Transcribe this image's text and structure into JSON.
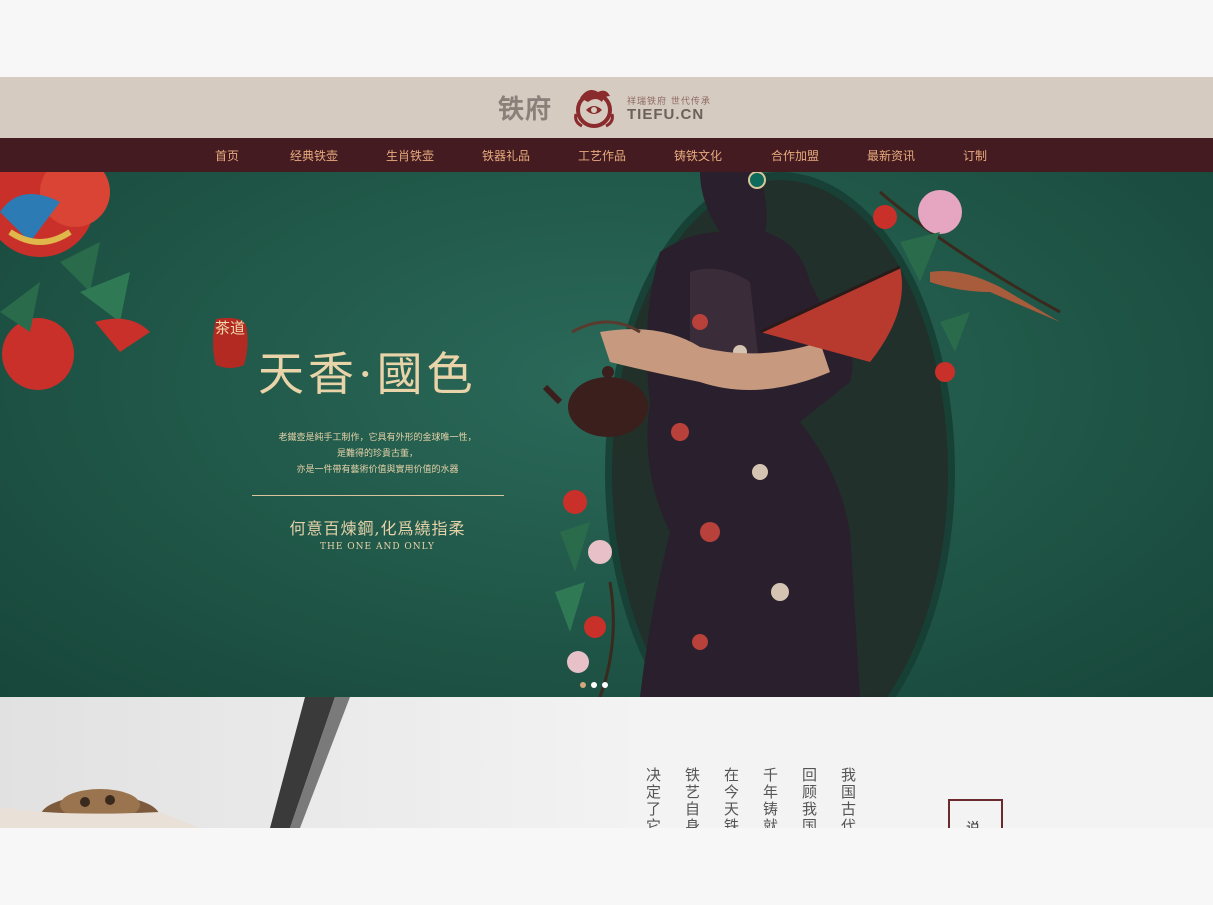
{
  "header": {
    "logo_text": "铁府",
    "logo_tagline": "祥瑞铁府 世代传承",
    "logo_domain": "TIEFU.CN"
  },
  "nav": {
    "items": [
      "首页",
      "经典铁壶",
      "生肖铁壶",
      "铁器礼品",
      "工艺作品",
      "铸铁文化",
      "合作加盟",
      "最新资讯",
      "订制"
    ]
  },
  "banner": {
    "seal_text": "茶道",
    "headline": "天香·國色",
    "desc_lines": [
      "老鐵壺是純手工制作，它具有外形的金球唯一性，",
      "是難得的珍貴古董，",
      "亦是一件帶有藝術价值與實用价值的水器"
    ],
    "slogan": "何意百煉鋼,化爲繞指柔",
    "slogan_en": "THE ONE AND ONLY",
    "carousel_active": 1,
    "carousel_count": 3
  },
  "intro": {
    "columns": [
      "决定了它",
      "铁艺自身",
      "在今天，铁",
      "千年铸就",
      "回顾我国",
      "我国古代"
    ],
    "frame_char": "说"
  },
  "colors": {
    "header_bg": "#d6cbc0",
    "nav_bg": "#431b20",
    "nav_text": "#e8ab7e",
    "banner_bg": "#1f5647",
    "accent_gold": "#e9d3a8"
  }
}
